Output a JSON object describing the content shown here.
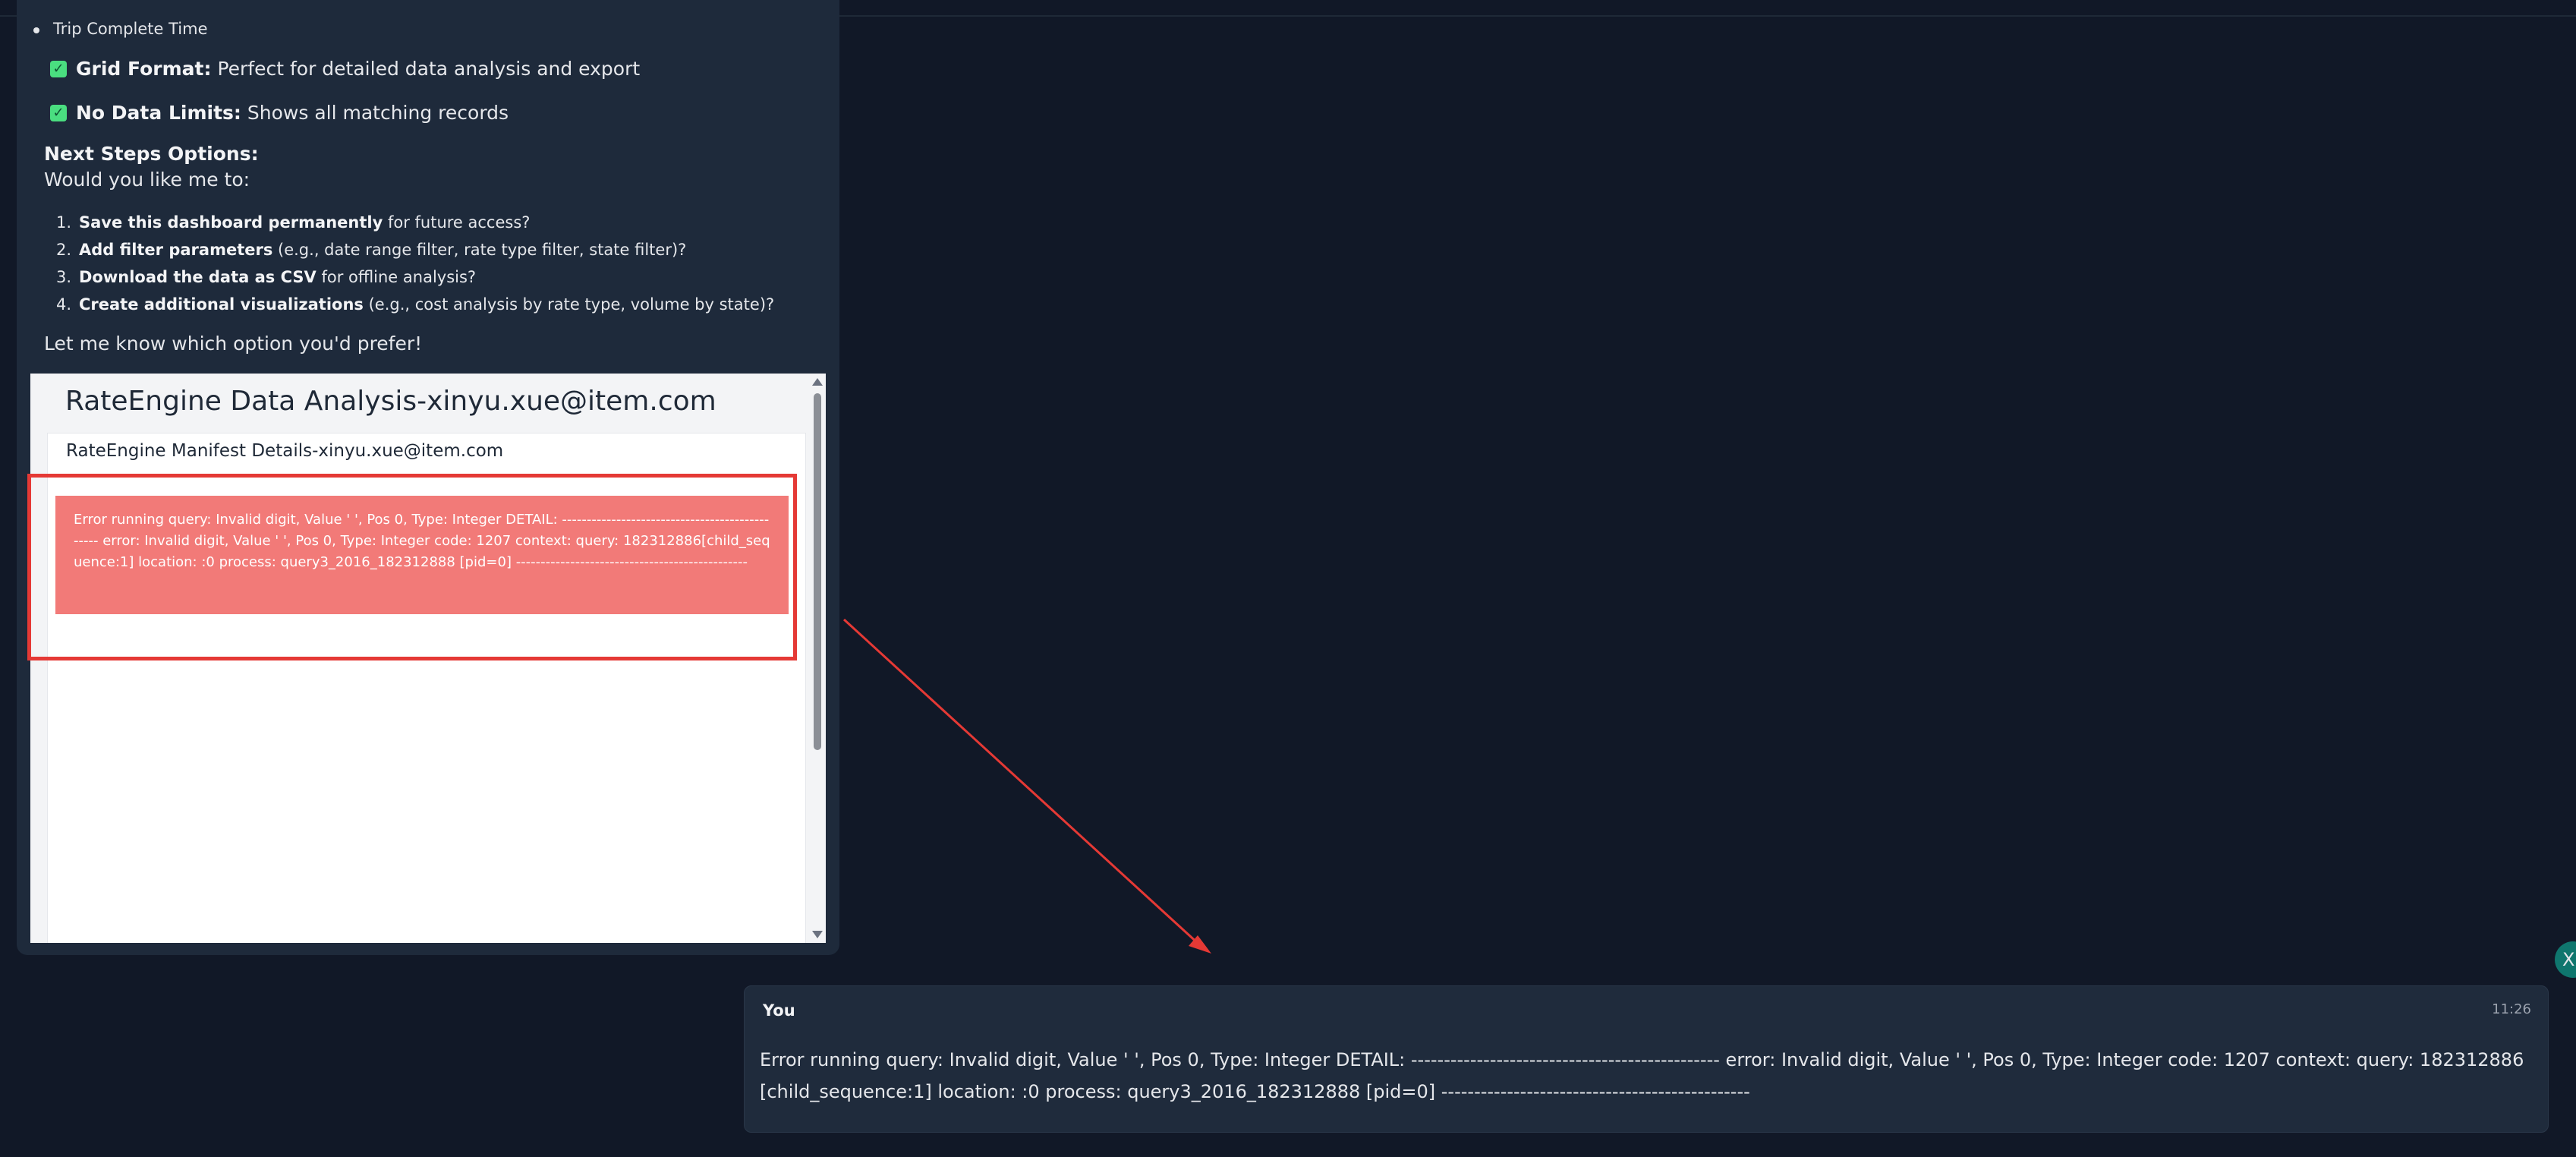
{
  "assistant": {
    "bullet_item": "Trip Complete Time",
    "features": [
      {
        "label": "Grid Format:",
        "text": "Perfect for detailed data analysis and export"
      },
      {
        "label": "No Data Limits:",
        "text": "Shows all matching records"
      }
    ],
    "next_steps_title": "Next Steps Options:",
    "next_steps_subtitle": "Would you like me to:",
    "steps": [
      {
        "num": "1.",
        "bold": "Save this dashboard permanently",
        "rest": " for future access?"
      },
      {
        "num": "2.",
        "bold": "Add filter parameters",
        "rest": " (e.g., date range filter, rate type filter, state filter)?"
      },
      {
        "num": "3.",
        "bold": "Download the data as CSV",
        "rest": " for offline analysis?"
      },
      {
        "num": "4.",
        "bold": "Create additional visualizations",
        "rest": " (e.g., cost analysis by rate type, volume by state)?"
      }
    ],
    "closing": "Let me know which option you'd prefer!"
  },
  "dashboard": {
    "title": "RateEngine Data Analysis-xinyu.xue@item.com",
    "subtitle": "RateEngine Manifest Details-xinyu.xue@item.com",
    "error_prefix": "Error running query: ",
    "error_message": "Invalid digit, Value ' ', Pos 0, Type: Integer DETAIL: ----------------------------------------------- error: Invalid digit, Value ' ', Pos 0, Type: Integer code: 1207 context: query: 182312886[child_sequence:1] location: :0 process: query3_2016_182312888 [pid=0] -----------------------------------------------"
  },
  "user_message": {
    "sender": "You",
    "time": "11:26",
    "text": "Error running query: Invalid digit, Value ' ', Pos 0, Type: Integer DETAIL: ----------------------------------------------- error: Invalid digit, Value ' ', Pos 0, Type: Integer code: 1207 context: query: 182312886[child_sequence:1] location: :0 process: query3_2016_182312888 [pid=0] -----------------------------------------------",
    "avatar_initial": "X"
  },
  "colors": {
    "background": "#111827",
    "card": "#1e2a3b",
    "error": "#f27a78",
    "annotation": "#e53935",
    "check": "#4ade80"
  },
  "icons": {
    "check": "check-square-icon",
    "bullet": "bullet-icon"
  }
}
